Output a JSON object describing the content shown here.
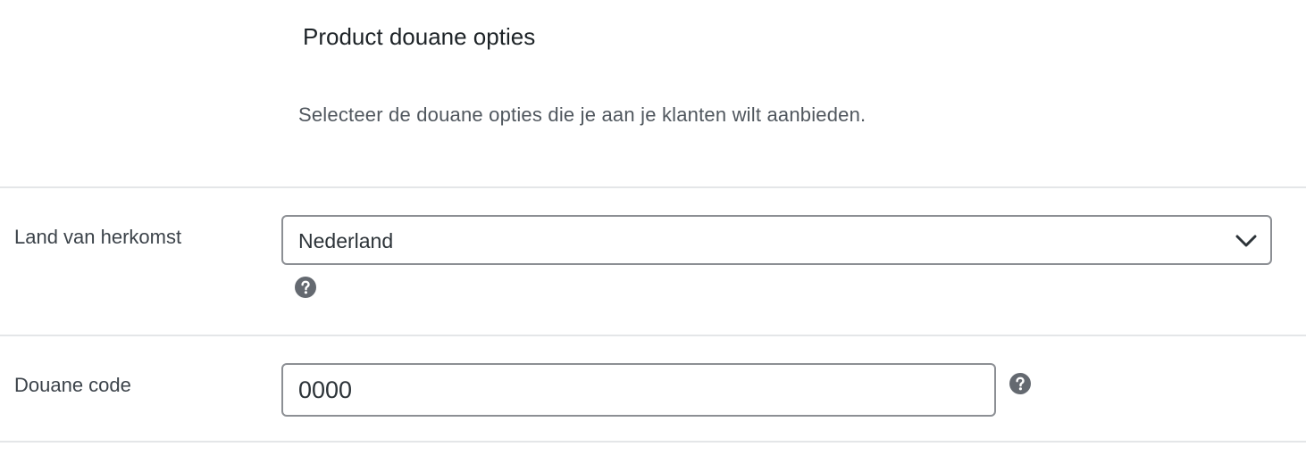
{
  "section": {
    "title": "Product douane opties",
    "description": "Selecteer de douane opties die je aan je klanten wilt aanbieden."
  },
  "fields": {
    "country_of_origin": {
      "label": "Land van herkomst",
      "selected_value": "Nederland",
      "icon": "chevron-down-icon",
      "help_icon": "help-icon"
    },
    "customs_code": {
      "label": "Douane code",
      "value": "0000",
      "help_icon": "help-icon"
    }
  },
  "colors": {
    "border": "#8c8f94",
    "divider": "#e4e6e8",
    "help_icon": "#646970",
    "text": "#3c434a"
  }
}
